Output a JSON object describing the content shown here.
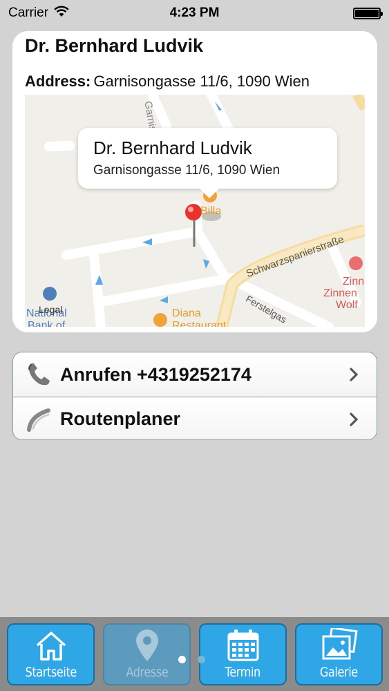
{
  "status_bar": {
    "carrier": "Carrier",
    "time": "4:23 PM",
    "battery_level": 1.0
  },
  "card": {
    "title": "Dr. Bernhard Ludvik",
    "address_label": "Address:",
    "address_value": "Garnisongasse 11/6, 1090 Wien"
  },
  "map": {
    "callout_title": "Dr. Bernhard Ludvik",
    "callout_subtitle": "Garnisongasse 11/6, 1090 Wien",
    "labels": {
      "garnis": "Garnisg",
      "billa": "Billa",
      "schwarz": "Schwarzspanierstraße",
      "ferstel": "Ferstelgas",
      "diana": "Diana",
      "diana_sub": "Restaurant",
      "zinnen1": "Zinn",
      "zinnen2": "Zinnen",
      "zinnen3": "Wolf",
      "national": "National",
      "bank": "Bank of"
    },
    "legal": "Legal",
    "pin_color": "#e8322c"
  },
  "actions": {
    "call_label": "Anrufen +4319252174",
    "route_label": "Routenplaner"
  },
  "tabs": [
    {
      "label": "Startseite",
      "icon": "home-icon",
      "active": true
    },
    {
      "label": "Adresse",
      "icon": "map-pin-icon",
      "active": false
    },
    {
      "label": "Termin",
      "icon": "calendar-icon",
      "active": true
    },
    {
      "label": "Galerie",
      "icon": "gallery-icon",
      "active": true
    }
  ],
  "colors": {
    "tab_active": "#2fa6e6",
    "tab_inactive": "#5c9bbe",
    "background": "#d3d3d3",
    "list_border": "#7f9aa3"
  }
}
